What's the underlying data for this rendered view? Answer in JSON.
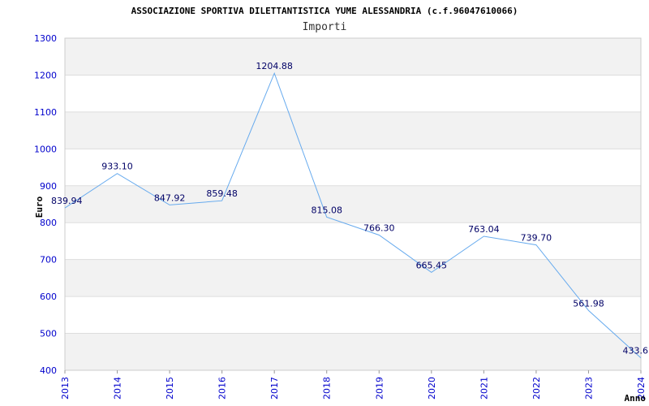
{
  "chart_data": {
    "type": "line",
    "title": "ASSOCIAZIONE SPORTIVA DILETTANTISTICA YUME ALESSANDRIA (c.f.96047610066)",
    "subtitle": "Importi",
    "xlabel": "Anno",
    "ylabel": "Euro",
    "ylim": [
      400,
      1300
    ],
    "yticks": [
      400,
      500,
      600,
      700,
      800,
      900,
      1000,
      1100,
      1200,
      1300
    ],
    "categories": [
      "2013",
      "2014",
      "2015",
      "2016",
      "2017",
      "2018",
      "2019",
      "2020",
      "2021",
      "2022",
      "2023",
      "2024"
    ],
    "series": [
      {
        "values": [
          839.94,
          933.1,
          847.92,
          859.48,
          1204.88,
          815.08,
          766.3,
          665.45,
          763.04,
          739.7,
          561.98,
          433.6
        ],
        "labels": [
          "839.94",
          "933.10",
          "847.92",
          "859.48",
          "1204.88",
          "815.08",
          "766.30",
          "665.45",
          "763.04",
          "739.70",
          "561.98",
          "433.6"
        ]
      }
    ],
    "grid": true,
    "line_color": "#66aaee",
    "band_color": "#f2f2f2",
    "tick_color": "#0000cc"
  }
}
